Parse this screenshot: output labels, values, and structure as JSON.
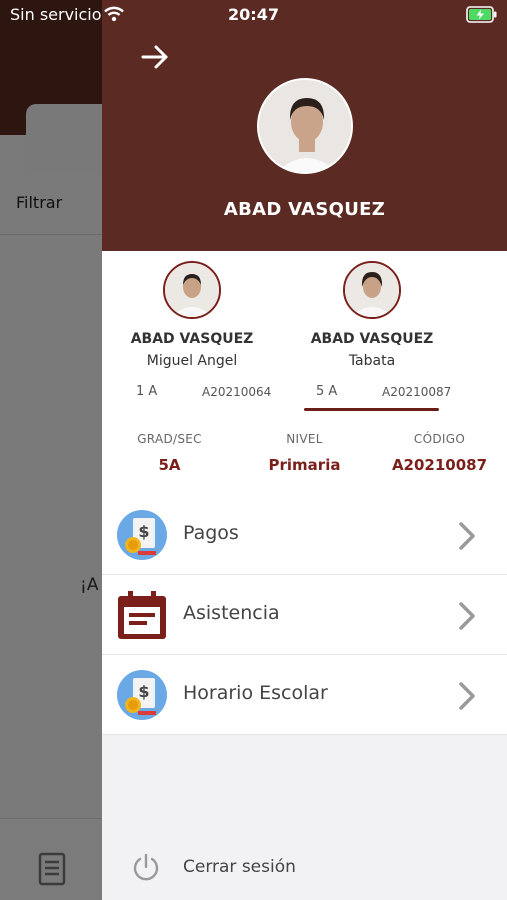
{
  "status_bar": {
    "carrier": "Sin servicio",
    "time": "20:47"
  },
  "background": {
    "filter_label": "Filtrar",
    "partial_text": "¡A"
  },
  "drawer": {
    "header_name": "ABAD VASQUEZ",
    "students": [
      {
        "last_name": "ABAD VASQUEZ",
        "first_name": "Miguel Angel",
        "grade": "1 A",
        "code": "A20210064",
        "selected": false
      },
      {
        "last_name": "ABAD VASQUEZ",
        "first_name": "Tabata",
        "grade": "5 A",
        "code": "A20210087",
        "selected": true
      }
    ],
    "info": [
      {
        "label": "GRAD/SEC",
        "value": "5A"
      },
      {
        "label": "NIVEL",
        "value": "Primaria"
      },
      {
        "label": "CÓDIGO",
        "value": "A20210087"
      }
    ],
    "menu": [
      {
        "label": "Pagos",
        "icon": "payment-icon"
      },
      {
        "label": "Asistencia",
        "icon": "calendar-icon"
      },
      {
        "label": "Horario Escolar",
        "icon": "payment-icon"
      }
    ],
    "logout_label": "Cerrar sesión"
  },
  "colors": {
    "header": "#5b2a22",
    "accent": "#7a1f1a",
    "status_text": "#ffffff"
  }
}
